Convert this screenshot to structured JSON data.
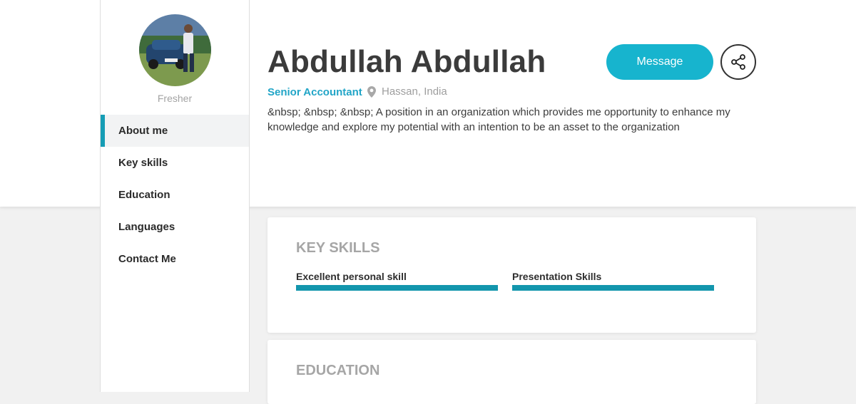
{
  "profile": {
    "name": "Abdullah Abdullah",
    "role": "Senior Accountant",
    "location": "Hassan, India",
    "status": "Fresher",
    "about": "&nbsp; &nbsp; &nbsp; A position in an organization which provides me opportunity to enhance my knowledge and explore my potential with an intention to be an asset to the organization"
  },
  "actions": {
    "message_label": "Message",
    "share_icon": "share-icon"
  },
  "nav": {
    "items": [
      {
        "label": "About me",
        "active": true
      },
      {
        "label": "Key skills",
        "active": false
      },
      {
        "label": "Education",
        "active": false
      },
      {
        "label": "Languages",
        "active": false
      },
      {
        "label": "Contact Me",
        "active": false
      }
    ]
  },
  "key_skills": {
    "title": "KEY SKILLS",
    "skills": [
      {
        "name": "Excellent personal skill",
        "level": 1.0
      },
      {
        "name": "Presentation Skills",
        "level": 1.0
      }
    ]
  },
  "education": {
    "title": "EDUCATION"
  },
  "colors": {
    "accent": "#17b4ce",
    "role": "#22a5c7",
    "skill_bar": "#1396ad"
  }
}
